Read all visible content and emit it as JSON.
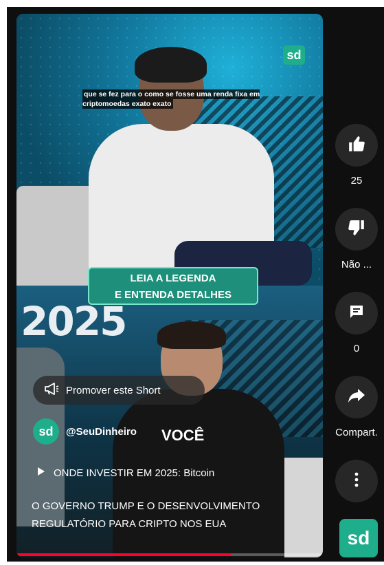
{
  "video": {
    "watermark": "sd",
    "caption": "que se fez para o como se fosse uma renda fixa em criptomoedas exato exato",
    "legend_box": {
      "line1": "LEIA A LEGENDA",
      "line2": "E ENTENDA DETALHES"
    },
    "background_text": "2025",
    "overlay_text": "VOCÊ",
    "progress_fraction": 0.7
  },
  "promote": {
    "label": "Promover este Short",
    "icon": "megaphone-icon"
  },
  "channel": {
    "avatar_text": "sd",
    "handle": "@SeuDinheiro"
  },
  "playlist": {
    "label": "ONDE INVESTIR EM 2025: Bitcoin",
    "icon": "play-icon"
  },
  "title": "O GOVERNO TRUMP E O DESENVOLVIMENTO REGULATÓRIO PARA CRIPTO NOS EUA",
  "rail": {
    "like": {
      "icon": "thumbs-up-icon",
      "label": "25"
    },
    "dislike": {
      "icon": "thumbs-down-icon",
      "label": "Não ..."
    },
    "comments": {
      "icon": "comment-icon",
      "label": "0"
    },
    "share": {
      "icon": "share-arrow-icon",
      "label": "Compart."
    },
    "more": {
      "icon": "more-vertical-icon"
    },
    "channel_badge": "sd"
  },
  "colors": {
    "brand": "#1fae8c",
    "progress": "#ff0033",
    "rail_button": "#272727"
  }
}
